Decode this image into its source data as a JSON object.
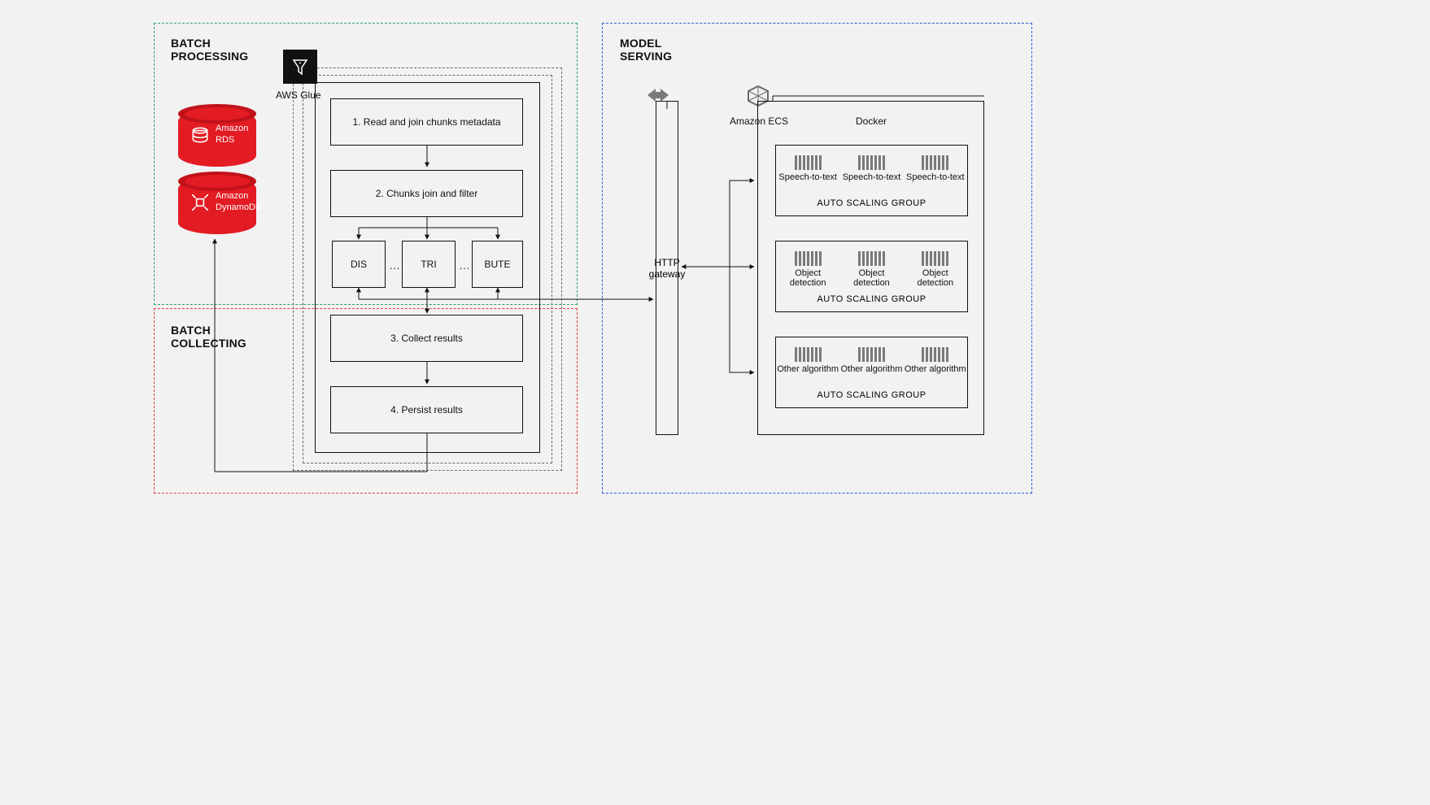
{
  "sections": {
    "batch_processing": {
      "title": "BATCH\nPROCESSING"
    },
    "batch_collecting": {
      "title": "BATCH\nCOLLECTING"
    },
    "model_serving": {
      "title": "MODEL\nSERVING"
    }
  },
  "aws": {
    "glue_label": "AWS Glue",
    "rds": {
      "line1": "Amazon",
      "line2": "RDS"
    },
    "dynamodb": {
      "line1": "Amazon",
      "line2": "DynamoDB"
    },
    "ecs_label": "Amazon ECS"
  },
  "steps": {
    "s1": "1. Read and join chunks metadata",
    "s2": "2. Chunks join and filter",
    "dis": "DIS",
    "tri": "TRI",
    "bute": "BUTE",
    "dots": "…",
    "s3": "3. Collect results",
    "s4": "4. Persist results"
  },
  "gateway": {
    "label": "HTTP\ngateway"
  },
  "docker_panel": {
    "title": "Docker"
  },
  "asg": {
    "group_title": "AUTO SCALING GROUP",
    "speech": "Speech-to-text",
    "object": "Object detection",
    "other": "Other algorithm"
  }
}
